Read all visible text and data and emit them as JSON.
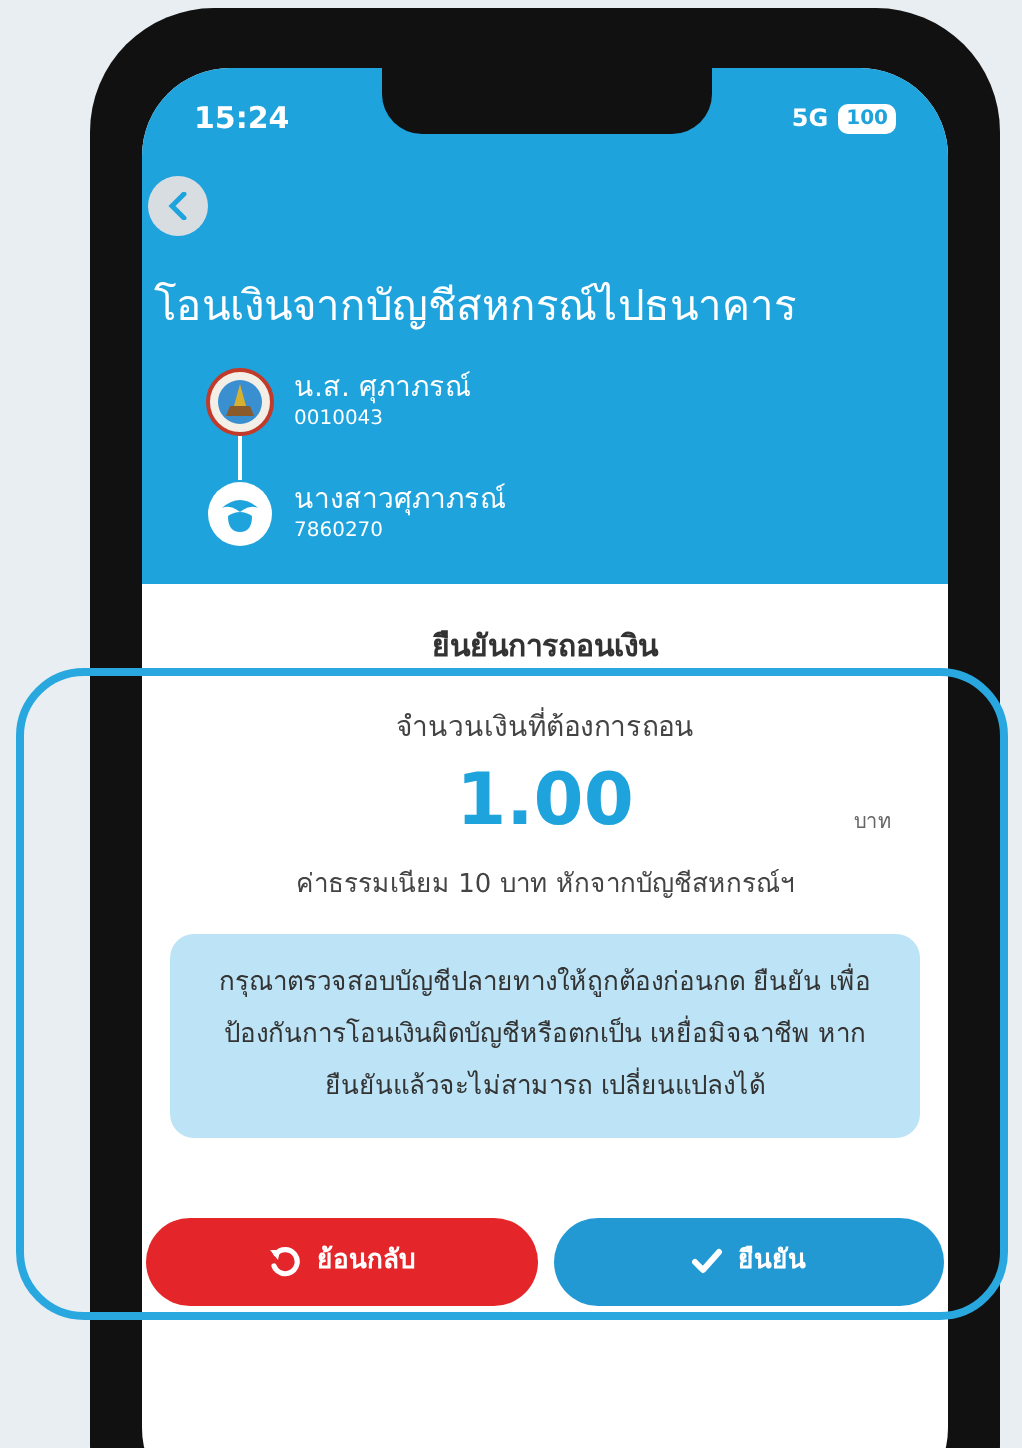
{
  "status_bar": {
    "time": "15:24",
    "network": "5G",
    "battery": "100"
  },
  "title": "โอนเงินจากบัญชีสหกรณ์ไปธนาคาร",
  "accounts": [
    {
      "name": "น.ส. ศุภาภรณ์",
      "number": "0010043",
      "kind": "coop"
    },
    {
      "name": "นางสาวศุภาภรณ์",
      "number": "7860270",
      "kind": "bank"
    }
  ],
  "confirm": {
    "heading": "ยืนยันการถอนเงิน",
    "amount_label": "จำนวนเงินที่ต้องการถอน",
    "amount": "1.00",
    "currency": "บาท",
    "fee_note": "ค่าธรรมเนียม 10 บาท หักจากบัญชีสหกรณ์ฯ",
    "warning": "กรุณาตรวจสอบบัญชีปลายทางให้ถูกต้องก่อนกด ยืนยัน เพื่อป้องกันการโอนเงินผิดบัญชีหรือตกเป็น เหยื่อมิจฉาชีพ หากยืนยันแล้วจะไม่สามารถ เปลี่ยนแปลงได้"
  },
  "buttons": [
    {
      "label": "ย้อนกลับ",
      "kind": "back"
    },
    {
      "label": "ยืนยัน",
      "kind": "confirm"
    }
  ]
}
